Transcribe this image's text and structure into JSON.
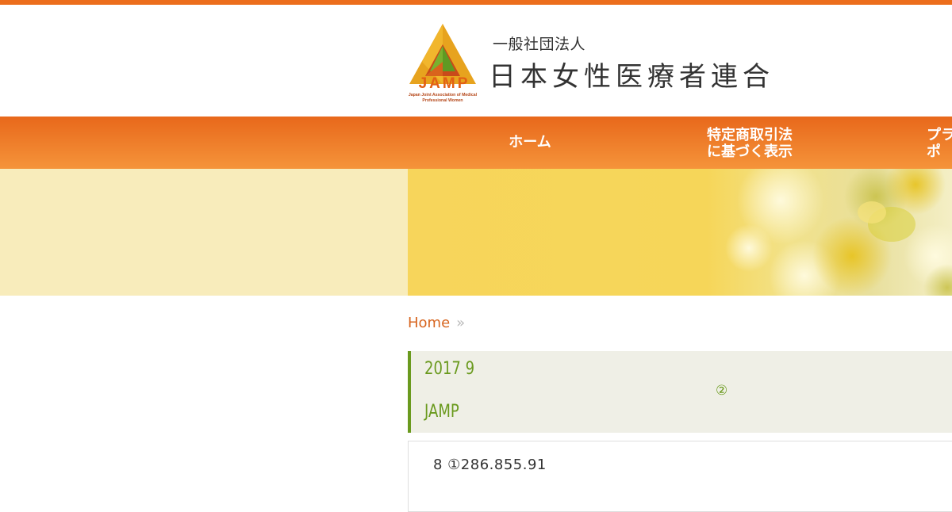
{
  "brand": {
    "logo_abbr": "JAMP",
    "logo_subtitle": "Japan Joint Association of Medical Professional Women",
    "org_kind": "一般社団法人",
    "org_name": "日本女性医療者連合",
    "colors": {
      "accent": "#ec6e1c",
      "green": "#6a9a1e",
      "banner": "#f7d55b"
    }
  },
  "nav": {
    "items": [
      {
        "label": "ホーム"
      },
      {
        "label": "特定商取引法\nに基づく表示"
      },
      {
        "label": "プラ\nポ"
      }
    ]
  },
  "breadcrumb": {
    "home": "Home",
    "separator": "»"
  },
  "post": {
    "date": "2017 9",
    "mark": "②",
    "title": "JAMP"
  },
  "content": {
    "line1": "8 ①286.855.91"
  }
}
